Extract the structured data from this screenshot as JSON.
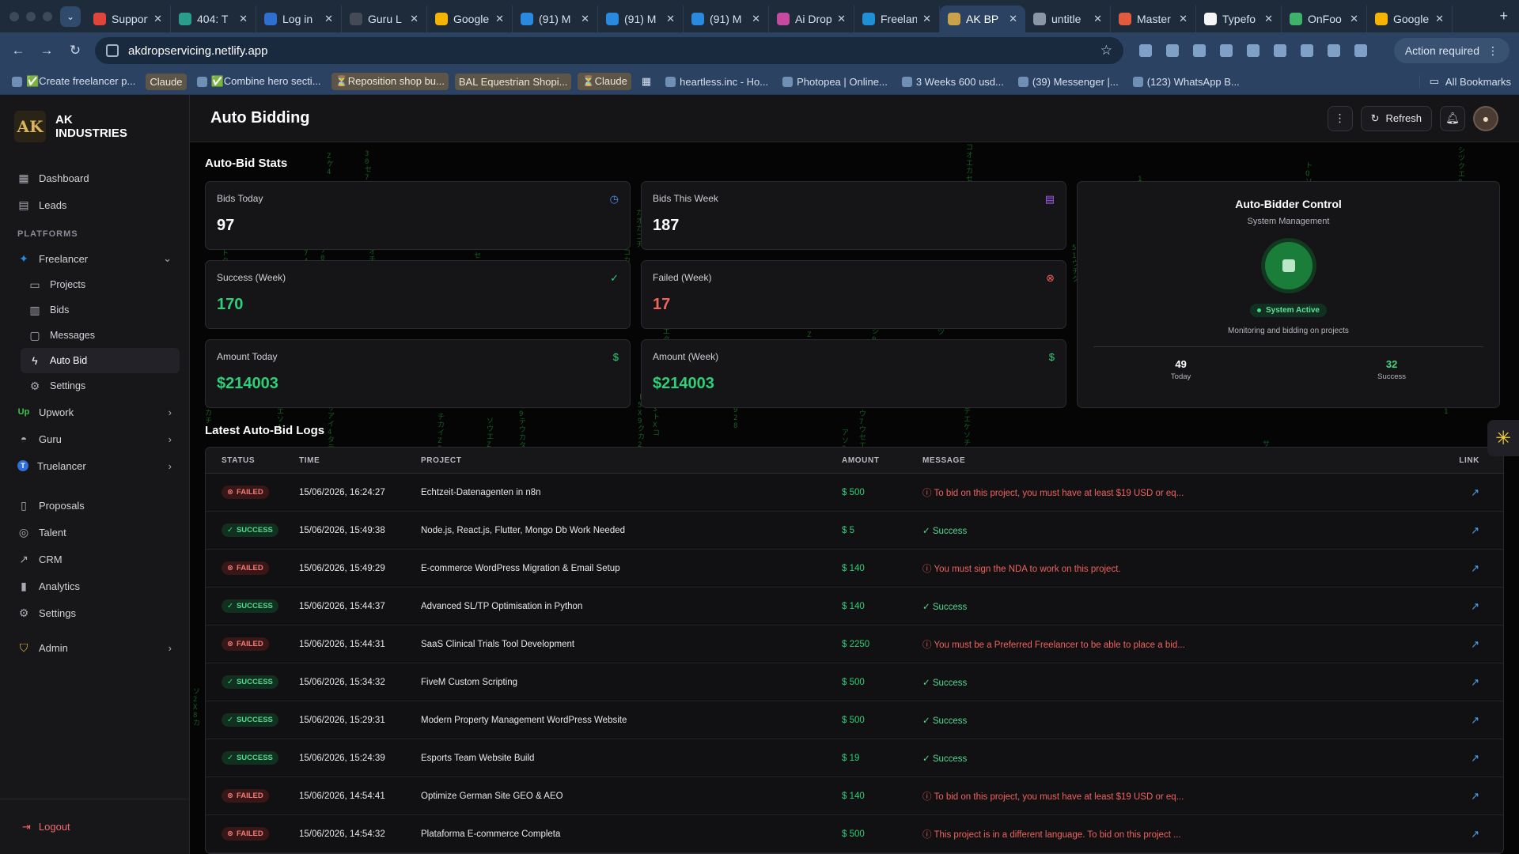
{
  "browser": {
    "tabs": [
      {
        "title": "Support",
        "color": "#e0443a"
      },
      {
        "title": "404: T",
        "color": "#2a9d8f"
      },
      {
        "title": "Log in",
        "color": "#2f6fd0"
      },
      {
        "title": "Guru L",
        "color": "#444b57"
      },
      {
        "title": "Google",
        "color": "#f4b400"
      },
      {
        "title": "(91) M",
        "color": "#2a8ae0"
      },
      {
        "title": "(91) M",
        "color": "#2a8ae0"
      },
      {
        "title": "(91) M",
        "color": "#2a8ae0"
      },
      {
        "title": "Ai Drop",
        "color": "#c64aa0"
      },
      {
        "title": "Freelan",
        "color": "#1f8fd6"
      },
      {
        "title": "AK BP",
        "color": "#c9a24a",
        "active": true
      },
      {
        "title": "untitle",
        "color": "#8a95a5"
      },
      {
        "title": "Master",
        "color": "#e25b3c"
      },
      {
        "title": "Typefo",
        "color": "#f5f5f5"
      },
      {
        "title": "OnFoo",
        "color": "#3eb26a"
      },
      {
        "title": "Google",
        "color": "#f4b400"
      }
    ],
    "url": "akdropservicing.netlify.app",
    "action_required": "Action required",
    "bookmarks": [
      {
        "label": "✅Create freelancer p...",
        "tag": false
      },
      {
        "label": "Claude",
        "tag": true
      },
      {
        "label": "✅Combine hero secti...",
        "tag": false
      },
      {
        "label": "⏳Reposition shop bu...",
        "tag": true
      },
      {
        "label": "BAL Equestrian Shopi...",
        "tag": true
      },
      {
        "label": "⏳Claude",
        "tag": true
      },
      {
        "label": "heartless.inc - Ho...",
        "tag": false
      },
      {
        "label": "Photopea | Online...",
        "tag": false
      },
      {
        "label": "3 Weeks  600 usd...",
        "tag": false
      },
      {
        "label": "(39) Messenger |...",
        "tag": false
      },
      {
        "label": "(123) WhatsApp B...",
        "tag": false
      }
    ],
    "all_bookmarks": "All Bookmarks"
  },
  "sidebar": {
    "brand_line1": "AK",
    "brand_line2": "INDUSTRIES",
    "dashboard": "Dashboard",
    "leads": "Leads",
    "platforms_heading": "PLATFORMS",
    "freelancer": "Freelancer",
    "freelancer_sub": [
      "Projects",
      "Bids",
      "Messages",
      "Auto Bid",
      "Settings"
    ],
    "upwork": "Upwork",
    "guru": "Guru",
    "truelancer": "Truelancer",
    "proposals": "Proposals",
    "talent": "Talent",
    "crm": "CRM",
    "analytics": "Analytics",
    "settings": "Settings",
    "admin": "Admin",
    "logout": "Logout"
  },
  "header": {
    "title": "Auto Bidding",
    "refresh": "Refresh"
  },
  "stats": {
    "section_title": "Auto-Bid Stats",
    "bids_today_label": "Bids Today",
    "bids_today": "97",
    "bids_week_label": "Bids This Week",
    "bids_week": "187",
    "success_label": "Success (Week)",
    "success": "170",
    "failed_label": "Failed (Week)",
    "failed": "17",
    "amount_today_label": "Amount Today",
    "amount_today": "$214003",
    "amount_week_label": "Amount (Week)",
    "amount_week": "$214003"
  },
  "control": {
    "title": "Auto-Bidder Control",
    "subtitle": "System Management",
    "status": "System Active",
    "monitoring": "Monitoring and bidding on projects",
    "today_value": "49",
    "today_label": "Today",
    "success_value": "32",
    "success_label": "Success"
  },
  "logs": {
    "section_title": "Latest Auto-Bid Logs",
    "columns": [
      "STATUS",
      "TIME",
      "PROJECT",
      "AMOUNT",
      "MESSAGE",
      "LINK"
    ],
    "rows": [
      {
        "status": "FAILED",
        "time": "15/06/2026, 16:24:27",
        "project": "Echtzeit-Datenagenten in n8n",
        "amount": "500",
        "message": "To bid on this project, you must have at least $19 USD or eq..."
      },
      {
        "status": "SUCCESS",
        "time": "15/06/2026, 15:49:38",
        "project": "Node.js, React.js, Flutter, Mongo Db Work Needed",
        "amount": "5",
        "message": "Success"
      },
      {
        "status": "FAILED",
        "time": "15/06/2026, 15:49:29",
        "project": "E-commerce WordPress Migration & Email Setup",
        "amount": "140",
        "message": "You must sign the NDA to work on this project."
      },
      {
        "status": "SUCCESS",
        "time": "15/06/2026, 15:44:37",
        "project": "Advanced SL/TP Optimisation in Python",
        "amount": "140",
        "message": "Success"
      },
      {
        "status": "FAILED",
        "time": "15/06/2026, 15:44:31",
        "project": "SaaS Clinical Trials Tool Development",
        "amount": "2250",
        "message": "You must be a Preferred Freelancer to be able to place a bid..."
      },
      {
        "status": "SUCCESS",
        "time": "15/06/2026, 15:34:32",
        "project": "FiveM Custom Scripting",
        "amount": "500",
        "message": "Success"
      },
      {
        "status": "SUCCESS",
        "time": "15/06/2026, 15:29:31",
        "project": "Modern Property Management WordPress Website",
        "amount": "500",
        "message": "Success"
      },
      {
        "status": "SUCCESS",
        "time": "15/06/2026, 15:24:39",
        "project": "Esports Team Website Build",
        "amount": "19",
        "message": "Success"
      },
      {
        "status": "FAILED",
        "time": "15/06/2026, 14:54:41",
        "project": "Optimize German Site GEO & AEO",
        "amount": "140",
        "message": "To bid on this project, you must have at least $19 USD or eq..."
      },
      {
        "status": "FAILED",
        "time": "15/06/2026, 14:54:32",
        "project": "Plataforma E-commerce Completa",
        "amount": "500",
        "message": "This project is in a different language. To bid on this project ..."
      }
    ]
  }
}
